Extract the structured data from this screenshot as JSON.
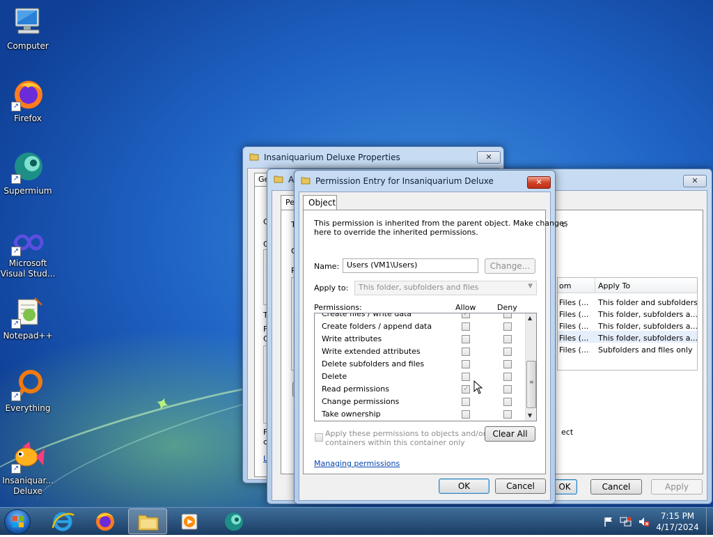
{
  "desktop": {
    "icons": [
      {
        "label": "Computer"
      },
      {
        "label": "Firefox"
      },
      {
        "label": "Supermium"
      },
      {
        "label_line1": "Microsoft",
        "label_line2": "Visual Stud..."
      },
      {
        "label": "Notepad++"
      },
      {
        "label": "Everything"
      },
      {
        "label_line1": "Insaniquar...",
        "label_line2": "Deluxe"
      }
    ]
  },
  "properties_window": {
    "title": "Insaniquarium Deluxe Properties",
    "close_glyph": "✕",
    "tab_partial": "Ge",
    "side_letters": [
      "G",
      "G",
      "T",
      "F",
      "C",
      "F",
      "c",
      "L",
      "O",
      "G"
    ]
  },
  "advanced_window": {
    "title_partial": "A",
    "close_glyph": "✕",
    "tab_partial": "Pe",
    "side_letters": [
      "T",
      "O",
      "P",
      "M"
    ],
    "text_frag_t": "t.",
    "text_frag_ect": "ect",
    "columns": {
      "from": "om",
      "apply_to": "Apply To"
    },
    "rows": [
      {
        "from": "Files (...",
        "apply_to": "This folder and subfolders"
      },
      {
        "from": "Files (...",
        "apply_to": "This folder, subfolders a..."
      },
      {
        "from": "Files (...",
        "apply_to": "This folder, subfolders a..."
      },
      {
        "from": "Files (...",
        "apply_to": "This folder, subfolders a..."
      },
      {
        "from": "Files (...",
        "apply_to": "Subfolders and files only"
      }
    ],
    "ok_label": "OK",
    "cancel_label": "Cancel",
    "apply_label": "Apply"
  },
  "permission_dialog": {
    "title": "Permission Entry for Insaniquarium Deluxe",
    "close_glyph": "✕",
    "tab_label": "Object",
    "info_line1": "This permission is inherited from the parent object. Make changes",
    "info_line2": "here to override the inherited permissions.",
    "name_label": "Name:",
    "name_value": "Users (VM1\\Users)",
    "change_label": "Change...",
    "apply_to_label": "Apply to:",
    "apply_to_value": "This folder, subfolders and files",
    "permissions_label": "Permissions:",
    "allow_header": "Allow",
    "deny_header": "Deny",
    "permissions": [
      {
        "name": "Create files / write data",
        "allow": true,
        "deny": false
      },
      {
        "name": "Create folders / append data",
        "allow": false,
        "deny": false
      },
      {
        "name": "Write attributes",
        "allow": false,
        "deny": false
      },
      {
        "name": "Write extended attributes",
        "allow": false,
        "deny": false
      },
      {
        "name": "Delete subfolders and files",
        "allow": false,
        "deny": false
      },
      {
        "name": "Delete",
        "allow": false,
        "deny": false
      },
      {
        "name": "Read permissions",
        "allow": true,
        "deny": false
      },
      {
        "name": "Change permissions",
        "allow": false,
        "deny": false
      },
      {
        "name": "Take ownership",
        "allow": false,
        "deny": false
      }
    ],
    "apply_children_line1": "Apply these permissions to objects and/or",
    "apply_children_line2": "containers within this container only",
    "clear_all_label": "Clear All",
    "managing_link": "Managing permissions",
    "ok_label": "OK",
    "cancel_label": "Cancel"
  },
  "taskbar": {
    "time": "7:15 PM",
    "date": "4/17/2024"
  }
}
